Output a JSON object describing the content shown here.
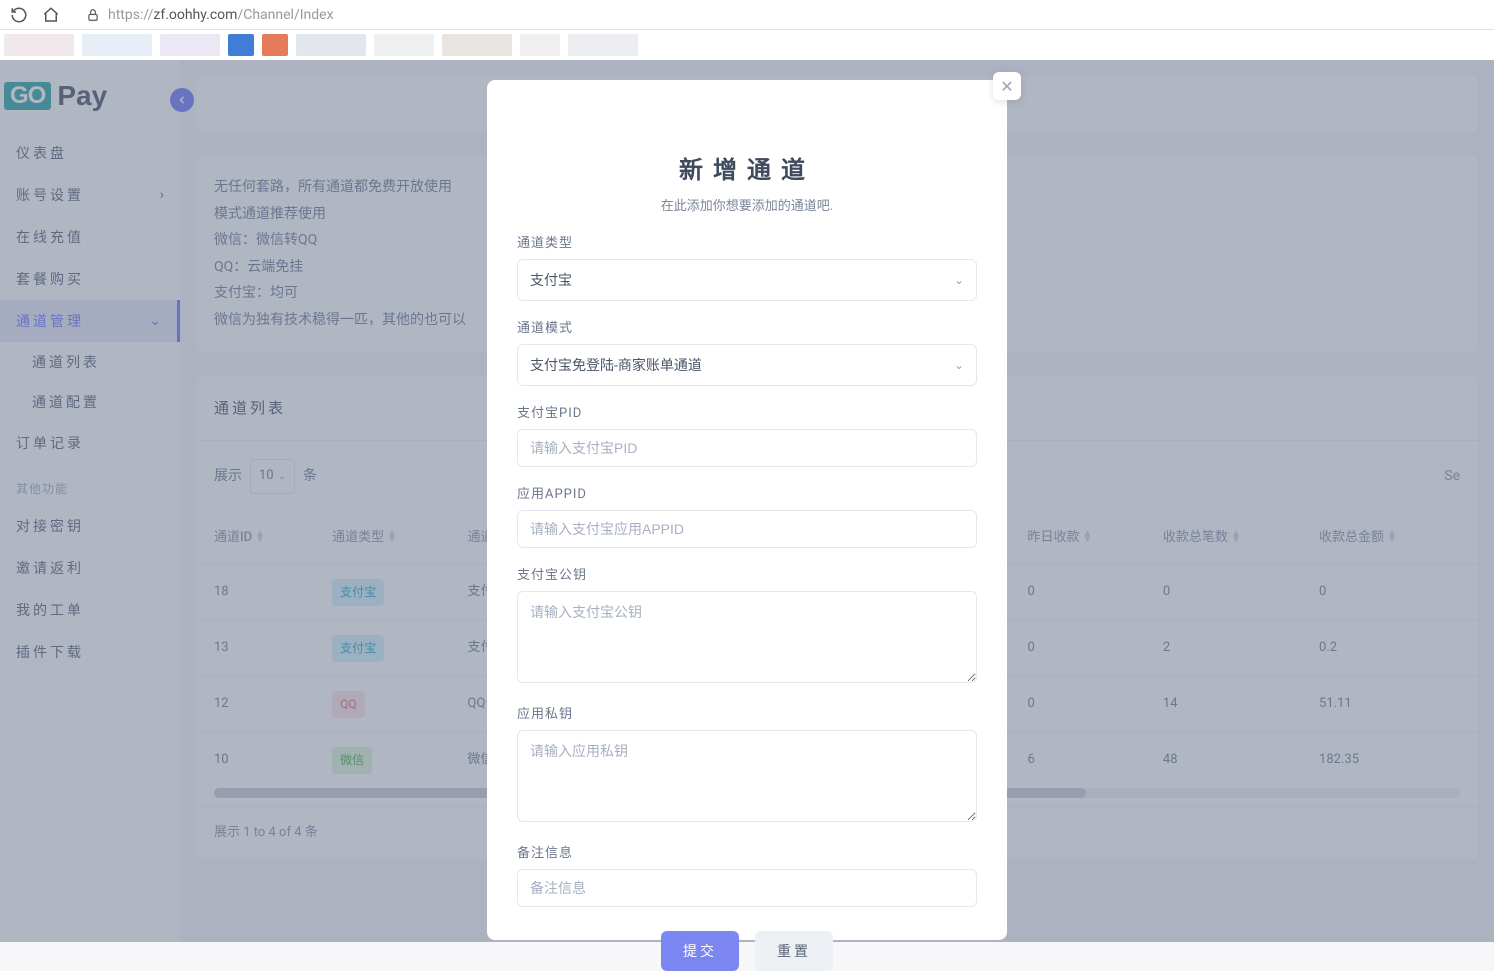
{
  "browser": {
    "url_prefix": "https://",
    "url_host": "zf.oohhy.com",
    "url_path": "/Channel/Index"
  },
  "logo": {
    "go": "GO",
    "pay": "Pay"
  },
  "nav": {
    "items": [
      {
        "label": "仪表盘"
      },
      {
        "label": "账号设置",
        "expandable": true
      },
      {
        "label": "在线充值"
      },
      {
        "label": "套餐购买"
      },
      {
        "label": "通道管理",
        "active": true,
        "expandable": true
      },
      {
        "label": "订单记录"
      }
    ],
    "channel_sub": [
      {
        "label": "通道列表"
      },
      {
        "label": "通道配置"
      }
    ],
    "other_label": "其他功能",
    "other_items": [
      {
        "label": "对接密钥"
      },
      {
        "label": "邀请返利"
      },
      {
        "label": "我的工单"
      },
      {
        "label": "插件下载"
      }
    ]
  },
  "info_card": {
    "line1": "无任何套路，所有通道都免费开放使用",
    "line2": "模式通道推荐使用",
    "line3": "微信：微信转QQ",
    "line4": "QQ：云端免挂",
    "line5": "支付宝：均可",
    "line6": "微信为独有技术稳得一匹，其他的也可以"
  },
  "table": {
    "title": "通道列表",
    "show_left": "展示",
    "page_size": "10",
    "show_right": "条",
    "search_label": "Se",
    "columns": [
      "通道ID",
      "通道类型",
      "通道模式",
      "昨日收款",
      "收款总笔数",
      "收款总金额"
    ],
    "rows": [
      {
        "id": "18",
        "type": "支付宝",
        "type_tag": "alipay",
        "mode": "支付宝商家",
        "yesterday": "0",
        "count": "0",
        "total": "0"
      },
      {
        "id": "13",
        "type": "支付宝",
        "type_tag": "alipay",
        "mode": "支付宝当面",
        "yesterday": "0",
        "count": "2",
        "total": "0.2"
      },
      {
        "id": "12",
        "type": "QQ",
        "type_tag": "qq",
        "mode": "QQ云端免挂",
        "yesterday": "0",
        "count": "14",
        "total": "51.11"
      },
      {
        "id": "10",
        "type": "微信",
        "type_tag": "wechat",
        "mode": "微信店员版",
        "yesterday": "6",
        "count": "48",
        "total": "182.35"
      }
    ],
    "footer": "展示 1 to 4 of 4 条"
  },
  "modal": {
    "title": "新增通道",
    "subtitle": "在此添加你想要添加的通道吧.",
    "fields": {
      "channel_type": {
        "label": "通道类型",
        "value": "支付宝"
      },
      "channel_mode": {
        "label": "通道模式",
        "value": "支付宝免登陆-商家账单通道"
      },
      "alipay_pid": {
        "label": "支付宝PID",
        "placeholder": "请输入支付宝PID"
      },
      "app_id": {
        "label": "应用APPID",
        "placeholder": "请输入支付宝应用APPID"
      },
      "alipay_pub": {
        "label": "支付宝公钥",
        "placeholder": "请输入支付宝公钥"
      },
      "app_priv": {
        "label": "应用私钥",
        "placeholder": "请输入应用私钥"
      },
      "remark": {
        "label": "备注信息",
        "placeholder": "备注信息"
      }
    },
    "submit": "提交",
    "reset": "重置"
  }
}
